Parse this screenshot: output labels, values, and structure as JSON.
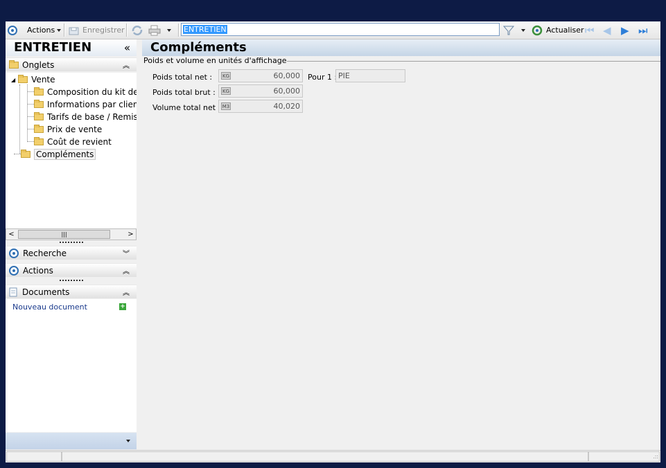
{
  "toolbar": {
    "actions_label": "Actions",
    "save_label": "Enregistrer",
    "search_value": "ENTRETIEN",
    "refresh_label": "Actualiser"
  },
  "left": {
    "title": "ENTRETIEN",
    "collapse_glyph": "«",
    "onglets_label": "Onglets",
    "tree": {
      "vente": "Vente",
      "children": [
        "Composition du kit de v",
        "Informations par client",
        "Tarifs de base / Remises",
        "Prix de vente",
        "Coût de revient"
      ],
      "complements": "Compléments"
    },
    "recherche_label": "Recherche",
    "actions_label": "Actions",
    "documents_label": "Documents",
    "new_document": "Nouveau document"
  },
  "right": {
    "title": "Compléments",
    "group_title": "Poids et volume en unités d'affichage",
    "rows": [
      {
        "label": "Poids total net :",
        "unit": "KG",
        "value": "60,000"
      },
      {
        "label": "Poids total brut :",
        "unit": "KG",
        "value": "60,000"
      },
      {
        "label": "Volume total net :",
        "unit": "M3",
        "value": "40,020"
      }
    ],
    "pour_label": "Pour 1 :",
    "pour_value": "PIE"
  }
}
